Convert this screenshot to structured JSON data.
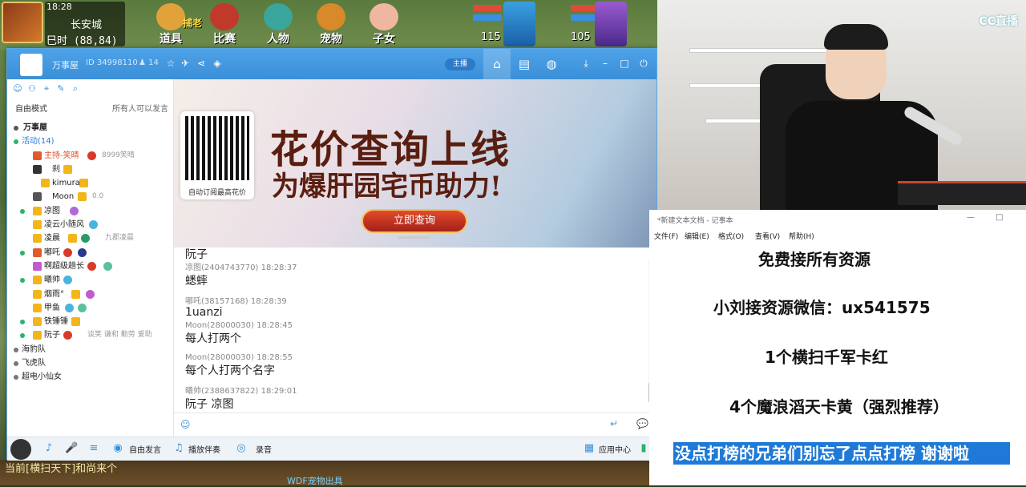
{
  "game": {
    "time": "18:28",
    "city": "长安城",
    "shichen": "巳时",
    "coords": "(88,84)",
    "buttons": [
      "道具",
      "比赛",
      "人物",
      "宠物",
      "子女"
    ],
    "badge_text": "捕老",
    "player_level": "115",
    "pet_level": "105",
    "bottom_text": "当前[横扫天下]和尚来个",
    "bottom_text2": "WDF宠物出具"
  },
  "cc": {
    "room_name": "万事屋",
    "room_id": "ID 34998110",
    "online": "14",
    "pill": "主播",
    "sidebar": {
      "mode": "自由模式",
      "mode_right": "所有人可以发言",
      "root": "万事屋",
      "activity": "活动(14)",
      "users": [
        {
          "name": "主持-笑晴",
          "sub": "8999笑晴"
        },
        {
          "name": "刹",
          "sub": ""
        },
        {
          "name": "kimura",
          "sub": ""
        },
        {
          "name": "Moon",
          "sub": "0.0"
        },
        {
          "name": "凉图",
          "sub": ""
        },
        {
          "name": "凌云小随风",
          "sub": ""
        },
        {
          "name": "凌晨",
          "sub": "九郡凌晨"
        },
        {
          "name": "嘟吒",
          "sub": ""
        },
        {
          "name": "啊超级趟长",
          "sub": ""
        },
        {
          "name": "曦帅",
          "sub": ""
        },
        {
          "name": "烟雨°",
          "sub": ""
        },
        {
          "name": "甲鱼",
          "sub": ""
        },
        {
          "name": "铁锤锤",
          "sub": ""
        },
        {
          "name": "阮子",
          "sub": "谈笑 谦和 勤劳 爱助"
        }
      ],
      "groups": [
        "海豹队",
        "飞虎队",
        "超电小仙女"
      ]
    },
    "banner": {
      "title": "花价查询上线",
      "subtitle": "为爆肝园宅币助力!",
      "button": "立即查询",
      "qr_caption": "自动订阅最高花价"
    },
    "chat": [
      {
        "meta": "",
        "text": "阮子"
      },
      {
        "meta": "凉图(2404743770) 18:28:37",
        "text": "蟋蟀"
      },
      {
        "meta": "哪吒(38157168) 18:28:39",
        "text": "1uanzi"
      },
      {
        "meta": "Moon(28000030) 18:28:45",
        "text": "每人打两个"
      },
      {
        "meta": "Moon(28000030) 18:28:55",
        "text": "每个人打两个名字"
      },
      {
        "meta": "曦帅(2388637822) 18:29:01",
        "text": "阮子 凉图"
      }
    ],
    "toolbar": {
      "free_speak": "自由发言",
      "play_music": "播放伴奏",
      "record": "录音",
      "app_center": "应用中心"
    }
  },
  "cam": {
    "logo": "CC直播"
  },
  "notepad": {
    "title": "*新建文本文档 - 记事本",
    "menu": [
      "文件(F)",
      "编辑(E)",
      "格式(O)",
      "查看(V)",
      "帮助(H)"
    ],
    "lines": [
      "免费接所有资源",
      "小刘接资源微信：ux541575",
      "1个横扫千军卡红",
      "4个魔浪滔天卡黄（强烈推荐）"
    ],
    "highlight": "没点打榜的兄弟们别忘了点点打榜 谢谢啦"
  }
}
